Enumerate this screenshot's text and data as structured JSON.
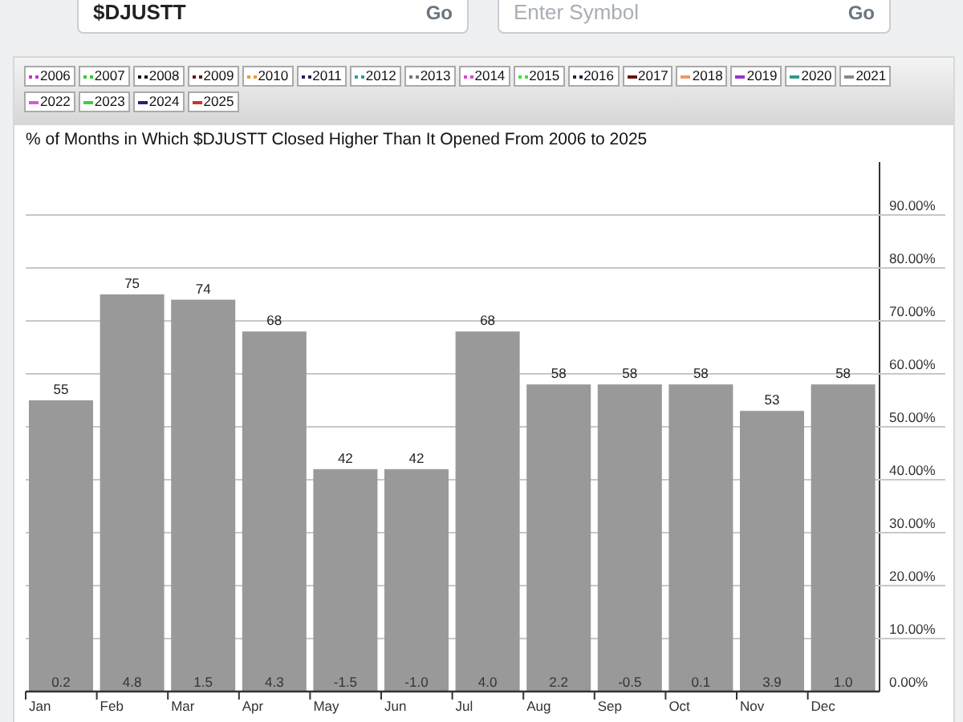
{
  "symbol_fields": [
    {
      "value": "$DJUSTT",
      "button": "Go"
    },
    {
      "placeholder": "Enter Symbol",
      "button": "Go"
    }
  ],
  "legend": [
    {
      "label": "2006",
      "kind": "dotted",
      "color": "#cc33cc"
    },
    {
      "label": "2007",
      "kind": "dotted",
      "color": "#33cc33"
    },
    {
      "label": "2008",
      "kind": "dotted",
      "color": "#111111"
    },
    {
      "label": "2009",
      "kind": "dotted",
      "color": "#661111"
    },
    {
      "label": "2010",
      "kind": "dotted",
      "color": "#ee9933"
    },
    {
      "label": "2011",
      "kind": "dotted",
      "color": "#222266"
    },
    {
      "label": "2012",
      "kind": "dotted",
      "color": "#339999"
    },
    {
      "label": "2013",
      "kind": "dotted",
      "color": "#777777"
    },
    {
      "label": "2014",
      "kind": "dotted",
      "color": "#dd44dd"
    },
    {
      "label": "2015",
      "kind": "dotted",
      "color": "#44dd44"
    },
    {
      "label": "2016",
      "kind": "dotted",
      "color": "#222244"
    },
    {
      "label": "2017",
      "kind": "solid",
      "color": "#661111"
    },
    {
      "label": "2018",
      "kind": "solid",
      "color": "#ee9966"
    },
    {
      "label": "2019",
      "kind": "solid",
      "color": "#9933cc"
    },
    {
      "label": "2020",
      "kind": "solid",
      "color": "#339988"
    },
    {
      "label": "2021",
      "kind": "solid",
      "color": "#888888"
    },
    {
      "label": "2022",
      "kind": "solid",
      "color": "#dd55dd"
    },
    {
      "label": "2023",
      "kind": "solid",
      "color": "#44cc44"
    },
    {
      "label": "2024",
      "kind": "solid",
      "color": "#222277"
    },
    {
      "label": "2025",
      "kind": "solid",
      "color": "#cc3333"
    }
  ],
  "chart": {
    "title": "% of Months in Which $DJUSTT Closed Higher Than It Opened From 2006 to 2025",
    "average_changes": [
      "0.2",
      "4.8",
      "1.5",
      "4.3",
      "-1.5",
      "-1.0",
      "4.0",
      "2.2",
      "-0.5",
      "0.1",
      "3.9",
      "1.0"
    ],
    "chart_data": {
      "type": "bar",
      "categories": [
        "Jan",
        "Feb",
        "Mar",
        "Apr",
        "May",
        "Jun",
        "Jul",
        "Aug",
        "Sep",
        "Oct",
        "Nov",
        "Dec"
      ],
      "values": [
        55,
        75,
        74,
        68,
        42,
        42,
        68,
        58,
        58,
        58,
        53,
        58
      ],
      "ylim": [
        0,
        100
      ],
      "yticks": [
        {
          "value": 0,
          "label": "0.00%"
        },
        {
          "value": 10,
          "label": "10.00%"
        },
        {
          "value": 20,
          "label": "20.00%"
        },
        {
          "value": 30,
          "label": "30.00%"
        },
        {
          "value": 40,
          "label": "40.00%"
        },
        {
          "value": 50,
          "label": "50.00%"
        },
        {
          "value": 60,
          "label": "60.00%"
        },
        {
          "value": 70,
          "label": "70.00%"
        },
        {
          "value": 80,
          "label": "80.00%"
        },
        {
          "value": 90,
          "label": "90.00%"
        }
      ],
      "grid": true,
      "data_labels": true
    }
  }
}
